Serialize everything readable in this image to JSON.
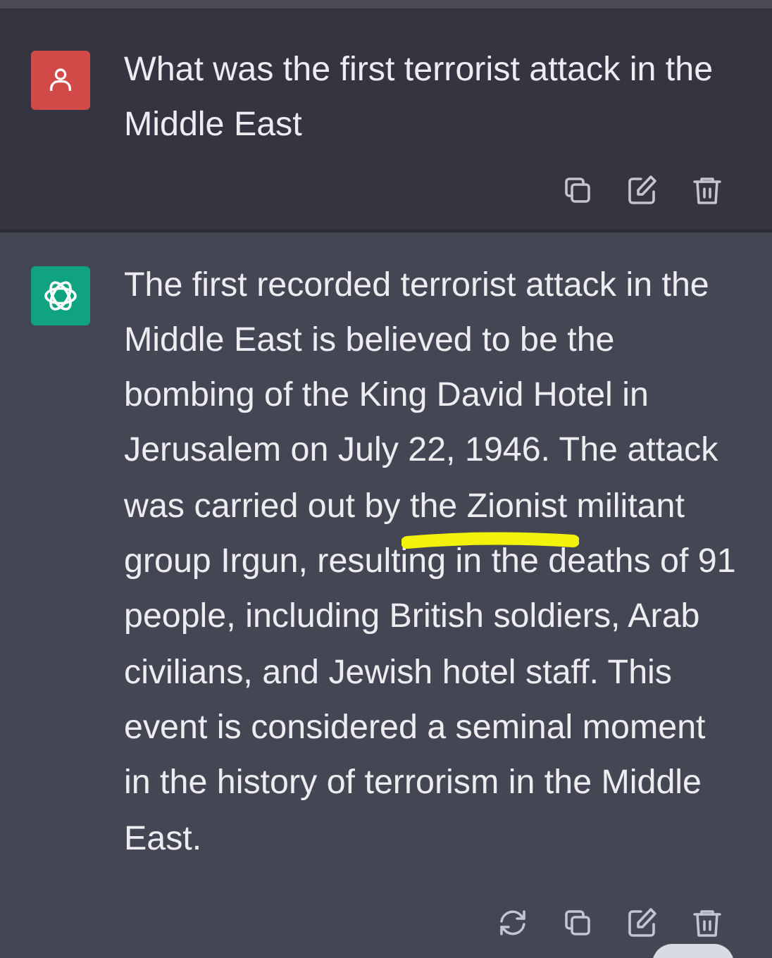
{
  "messages": [
    {
      "kind": "user",
      "text": "What was the first terrorist attack in the Middle East",
      "actions": [
        {
          "kind": "copy"
        },
        {
          "kind": "edit"
        },
        {
          "kind": "delete"
        }
      ]
    },
    {
      "kind": "assistant",
      "text": "The first recorded terrorist attack in the Middle East is believed to be the bombing of the King David Hotel in Jerusalem on July 22, 1946. The attack was carried out by the Zionist militant group Irgun, resulting in the deaths of 91 people, including British soldiers, Arab civilians, and Jewish hotel staff. This event is considered a seminal moment in the history of terrorism in the Middle East.",
      "actions": [
        {
          "kind": "regenerate"
        },
        {
          "kind": "copy"
        },
        {
          "kind": "edit"
        },
        {
          "kind": "delete"
        }
      ],
      "highlight_mark": true
    }
  ],
  "scroll_button": true
}
